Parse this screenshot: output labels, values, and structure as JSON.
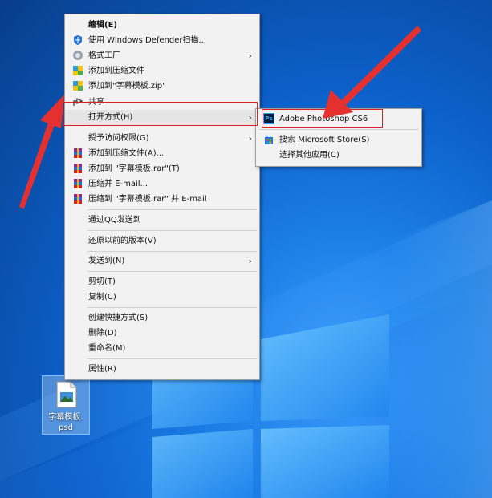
{
  "colors": {
    "accent_red": "#e02020",
    "menu_bg": "#f2f2f2",
    "desktop_blue": "#0c5fc8"
  },
  "context_menu": {
    "items": [
      {
        "label": "编辑(E)",
        "icon": "none",
        "bold": true
      },
      {
        "label": "使用 Windows Defender扫描...",
        "icon": "shield-icon"
      },
      {
        "label": "格式工厂",
        "icon": "format-factory-icon",
        "submenu": true
      },
      {
        "label": "添加到压缩文件",
        "icon": "zip-icon"
      },
      {
        "label": "添加到\"字幕模板.zip\"",
        "icon": "zip-icon"
      },
      {
        "label": "共享",
        "icon": "share-icon"
      },
      {
        "label": "打开方式(H)",
        "icon": "none",
        "submenu": true,
        "highlighted": true
      },
      {
        "label": "授予访问权限(G)",
        "icon": "none",
        "submenu": true
      },
      {
        "label": "添加到压缩文件(A)...",
        "icon": "winrar-icon"
      },
      {
        "label": "添加到 \"字幕模板.rar\"(T)",
        "icon": "winrar-icon"
      },
      {
        "label": "压缩并 E-mail...",
        "icon": "winrar-icon"
      },
      {
        "label": "压缩到 \"字幕模板.rar\" 并 E-mail",
        "icon": "winrar-icon"
      },
      {
        "label": "通过QQ发送到",
        "icon": "none"
      },
      {
        "label": "还原以前的版本(V)",
        "icon": "none"
      },
      {
        "label": "发送到(N)",
        "icon": "none",
        "submenu": true
      },
      {
        "label": "剪切(T)",
        "icon": "none"
      },
      {
        "label": "复制(C)",
        "icon": "none"
      },
      {
        "label": "创建快捷方式(S)",
        "icon": "none"
      },
      {
        "label": "删除(D)",
        "icon": "none"
      },
      {
        "label": "重命名(M)",
        "icon": "none"
      },
      {
        "label": "属性(R)",
        "icon": "none"
      }
    ]
  },
  "open_with_submenu": {
    "items": [
      {
        "label": "Adobe Photoshop CS6",
        "icon": "photoshop-icon",
        "icon_text": "Ps"
      },
      {
        "label": "搜索 Microsoft Store(S)",
        "icon": "store-icon"
      },
      {
        "label": "选择其他应用(C)",
        "icon": "none"
      }
    ]
  },
  "desktop_file": {
    "name_line1": "字幕模板.",
    "name_line2": "psd",
    "icon": "psd-file-icon"
  }
}
